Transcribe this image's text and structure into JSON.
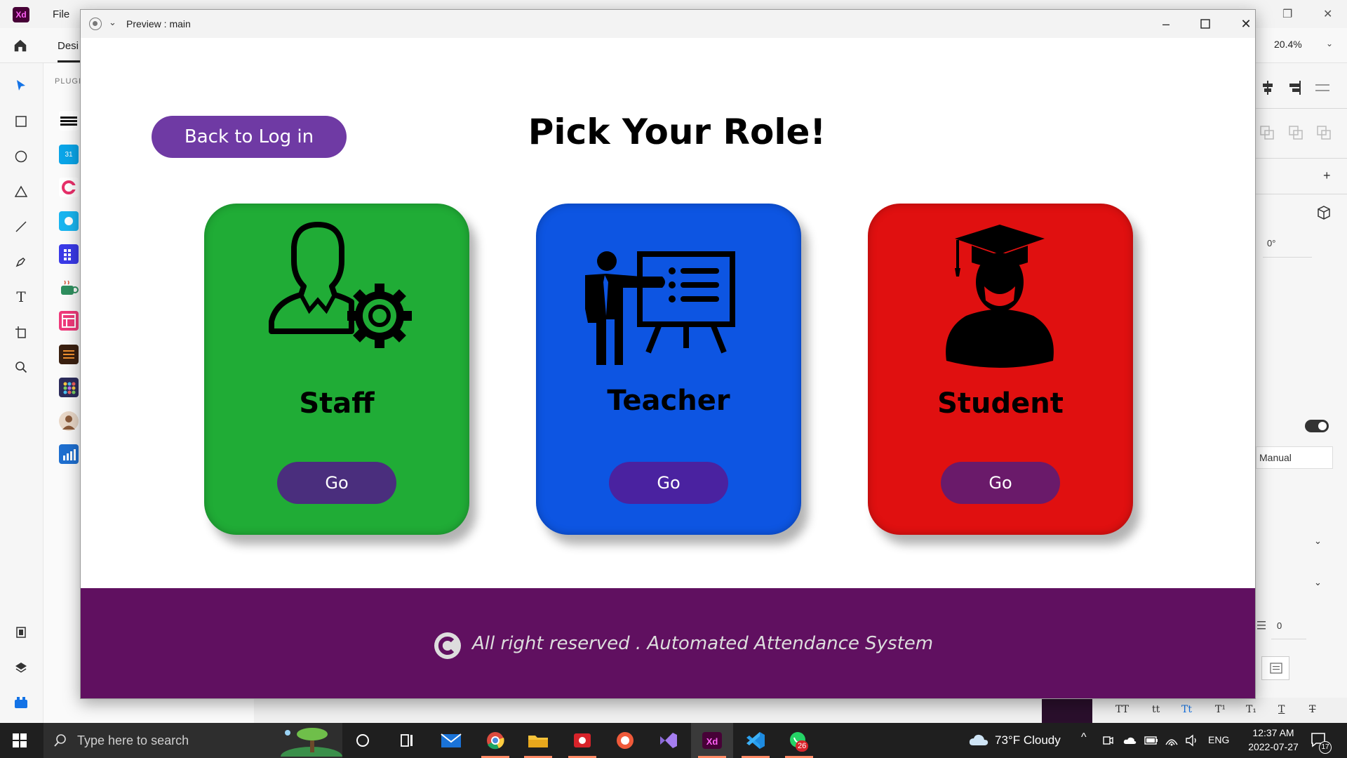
{
  "xd": {
    "menu_file": "File",
    "tab_design": "Desi",
    "zoom": "20.4%",
    "plugins_label": "PLUGI",
    "rotation": "0°",
    "layout_mode": "Manual",
    "spacing_value": "0"
  },
  "preview": {
    "title": "Preview : main",
    "back_button": "Back to Log in",
    "heading": "Pick Your Role!",
    "cards": [
      {
        "label": "Staff",
        "button": "Go",
        "color": "#20ac36",
        "button_color": "#4a2e7d"
      },
      {
        "label": "Teacher",
        "button": "Go",
        "color": "#0d55e2",
        "button_color": "#4a22a0"
      },
      {
        "label": "Student",
        "button": "Go",
        "color": "#e01010",
        "button_color": "#6a1a6a"
      }
    ],
    "footer_text": "All right reserved . Automated Attendance System",
    "footer_color": "#601060",
    "accent_color": "#6f3aa4"
  },
  "taskbar": {
    "search_placeholder": "Type here to search",
    "weather": "73°F  Cloudy",
    "language": "ENG",
    "time": "12:37 AM",
    "date": "2022-07-27",
    "whatsapp_badge": "26",
    "notification_count": "17"
  }
}
